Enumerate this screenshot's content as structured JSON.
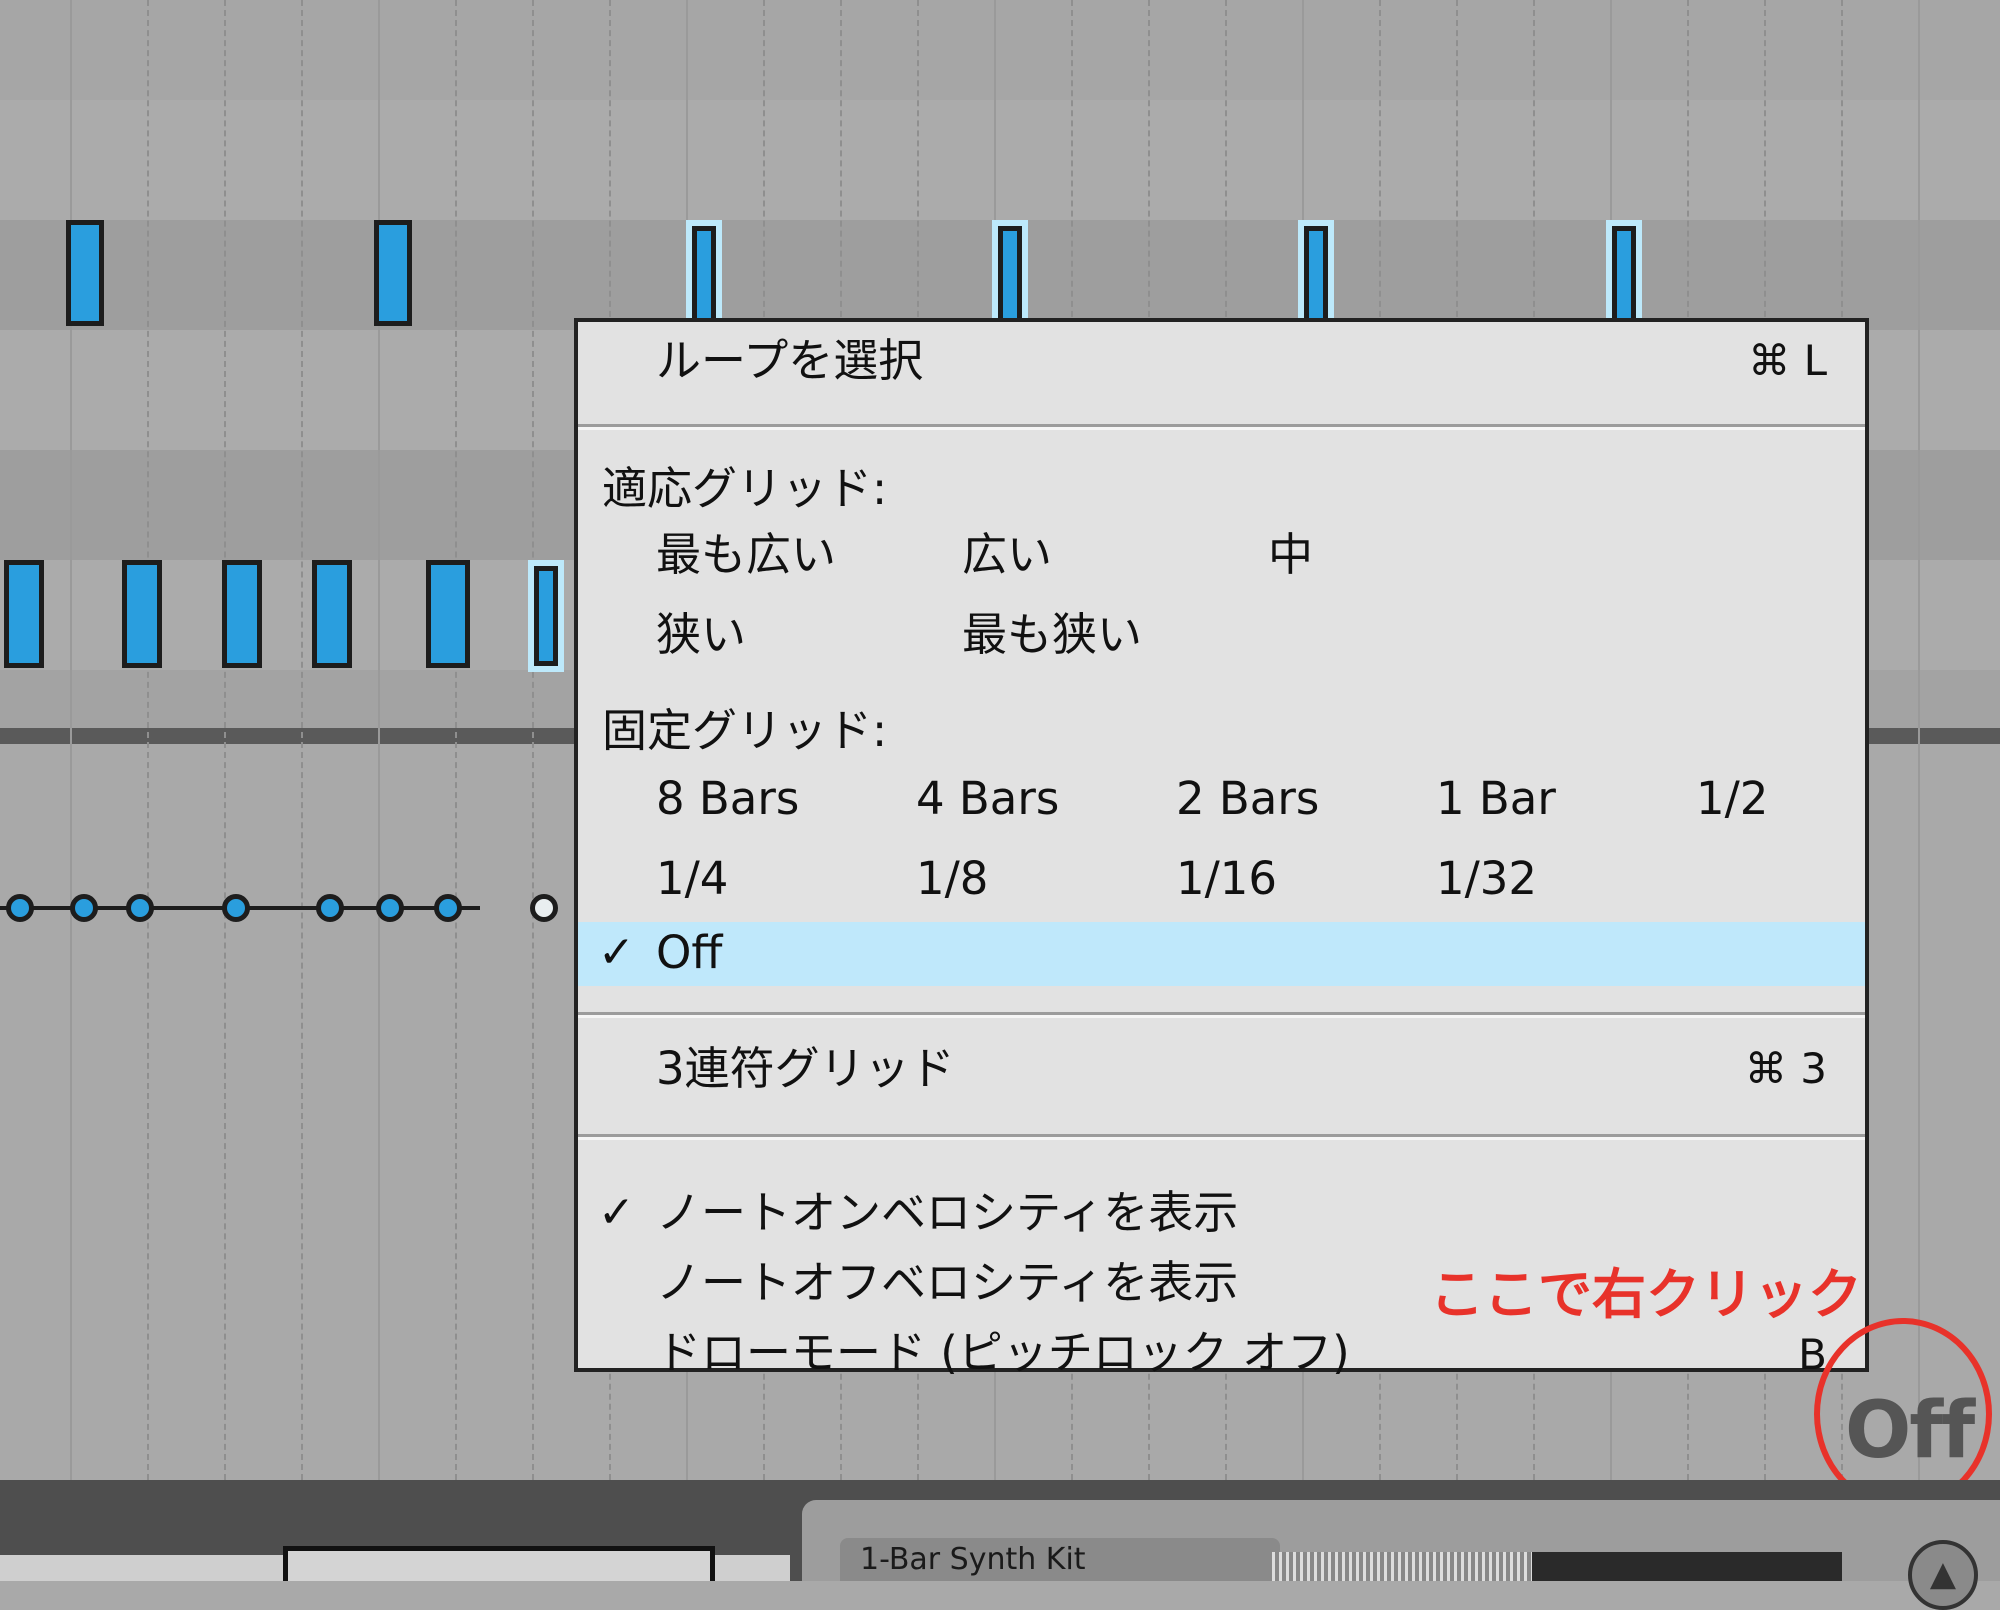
{
  "context_menu": {
    "select_loop": {
      "label": "ループを選択",
      "shortcut": "⌘ L"
    },
    "adaptive_grid": {
      "heading": "適応グリッド:",
      "options": [
        "最も広い",
        "広い",
        "中",
        "狭い",
        "最も狭い"
      ]
    },
    "fixed_grid": {
      "heading": "固定グリッド:",
      "options": [
        "8 Bars",
        "4 Bars",
        "2 Bars",
        "1 Bar",
        "1/2",
        "1/4",
        "1/8",
        "1/16",
        "1/32"
      ]
    },
    "off": {
      "label": "Off",
      "checked": true,
      "check_mark": "✓"
    },
    "triplet_grid": {
      "label": "3連符グリッド",
      "shortcut": "⌘ 3"
    },
    "show_note_on_velocity": {
      "label": "ノートオンベロシティを表示",
      "checked": true,
      "check_mark": "✓"
    },
    "show_note_off_velocity": {
      "label": "ノートオフベロシティを表示"
    },
    "draw_mode": {
      "label": "ドローモード (ピッチロック オフ)",
      "shortcut": "B"
    }
  },
  "annotation": {
    "text": "ここで右クリック",
    "color": "#e8322a"
  },
  "grid_button": {
    "label": "Off"
  },
  "clip": {
    "name": "1-Bar Synth Kit"
  },
  "colors": {
    "note": "#2a9ede",
    "highlight": "#bfe8fb",
    "menu_bg": "#e2e2e2",
    "annotation": "#e8322a"
  }
}
